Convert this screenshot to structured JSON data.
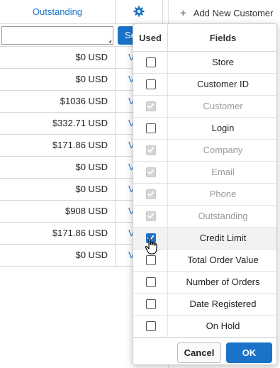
{
  "colors": {
    "accent": "#1a73c8",
    "disabled_text": "#9a9a9a"
  },
  "background_table": {
    "header_outstanding": "Outstanding",
    "gear_icon": "gear-icon",
    "search_button_label": "Se",
    "filter_value": "",
    "rows": [
      {
        "amount": "$0 USD",
        "link": "V"
      },
      {
        "amount": "$0 USD",
        "link": "V"
      },
      {
        "amount": "$1036 USD",
        "link": "V"
      },
      {
        "amount": "$332.71 USD",
        "link": "V"
      },
      {
        "amount": "$171.86 USD",
        "link": "V"
      },
      {
        "amount": "$0 USD",
        "link": "V"
      },
      {
        "amount": "$0 USD",
        "link": "V"
      },
      {
        "amount": "$908 USD",
        "link": "V"
      },
      {
        "amount": "$171.86 USD",
        "link": "V"
      },
      {
        "amount": "$0 USD",
        "link": "V"
      }
    ]
  },
  "right_panel": {
    "add_customer_label": "Add New Customer"
  },
  "popup": {
    "col_used": "Used",
    "col_fields": "Fields",
    "fields": [
      {
        "label": "Store",
        "checked": false,
        "disabled": false
      },
      {
        "label": "Customer ID",
        "checked": false,
        "disabled": false
      },
      {
        "label": "Customer",
        "checked": true,
        "disabled": true
      },
      {
        "label": "Login",
        "checked": false,
        "disabled": false
      },
      {
        "label": "Company",
        "checked": true,
        "disabled": true
      },
      {
        "label": "Email",
        "checked": true,
        "disabled": true
      },
      {
        "label": "Phone",
        "checked": true,
        "disabled": true
      },
      {
        "label": "Outstanding",
        "checked": true,
        "disabled": true
      },
      {
        "label": "Credit Limit",
        "checked": true,
        "disabled": false
      },
      {
        "label": "Total Order Value",
        "checked": false,
        "disabled": false
      },
      {
        "label": "Number of Orders",
        "checked": false,
        "disabled": false
      },
      {
        "label": "Date Registered",
        "checked": false,
        "disabled": false
      },
      {
        "label": "On Hold",
        "checked": false,
        "disabled": false
      }
    ],
    "cancel_label": "Cancel",
    "ok_label": "OK"
  }
}
